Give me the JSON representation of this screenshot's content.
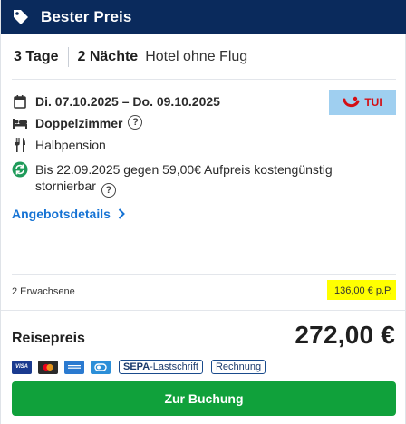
{
  "header": {
    "title": "Bester Preis",
    "icon": "tag-icon"
  },
  "summary": {
    "days": "3 Tage",
    "nights": "2 Nächte",
    "type": "Hotel ohne Flug"
  },
  "details": {
    "dates": "Di. 07.10.2025 – Do. 09.10.2025",
    "room": "Doppelzimmer",
    "board": "Halbpension",
    "cancellation": "Bis 22.09.2025 gegen 59,00€ Aufpreis kostengünstig stornierbar"
  },
  "provider": {
    "name": "TUI",
    "logo_bg": "#9fcff0",
    "logo_color": "#d40e14"
  },
  "link": {
    "label": "Angebotsdetails"
  },
  "pricing": {
    "travelers": "2 Erwachsene",
    "per_person": "136,00 € p.P.",
    "label": "Reisepreis",
    "total": "272,00 €"
  },
  "payments": {
    "visa": "VISA",
    "sepa_strong": "SEPA",
    "sepa_rest": "-Lastschrift",
    "invoice": "Rechnung"
  },
  "cta": {
    "label": "Zur Buchung",
    "color": "#10a13b"
  },
  "colors": {
    "header_bg": "#0a2a5c",
    "link": "#1673d4",
    "highlight": "#ffff00"
  }
}
